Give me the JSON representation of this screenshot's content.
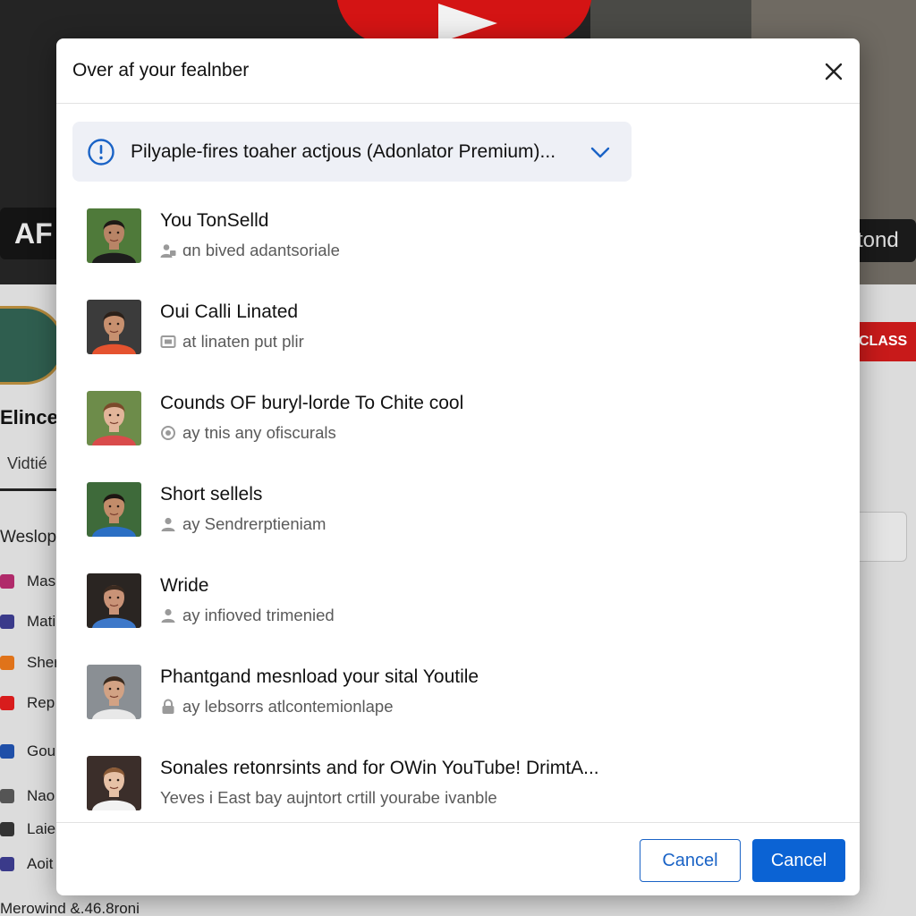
{
  "background": {
    "badge_left": "AF",
    "badge_right": "tond",
    "channel_name": "Elince",
    "tab_label": "Vidtié",
    "subscribe_label": "CLASS",
    "section_label": "Weslop",
    "sidebar": [
      {
        "label": "Mas",
        "icon": "heart-icon",
        "color": "#b02a6a"
      },
      {
        "label": "Mati",
        "icon": "list-icon",
        "color": "#3a3a8a"
      },
      {
        "label": "Sher",
        "icon": "image-icon",
        "color": "#e0731a"
      },
      {
        "label": "Rep",
        "icon": "play-icon",
        "color": "#d81c1c"
      },
      {
        "label": "Gou",
        "icon": "facebook-icon",
        "color": "#1f4fa8"
      },
      {
        "label": "Nao",
        "icon": "box-icon",
        "color": "#555555"
      },
      {
        "label": "Laie",
        "icon": "chat-icon",
        "color": "#333333"
      },
      {
        "label": "Aoit",
        "icon": "chart-icon",
        "color": "#3a3a8a"
      }
    ],
    "footer_text": "Merowind &.46.8roni"
  },
  "modal": {
    "title": "Over af your fealnber",
    "close_icon": "close-icon",
    "notice": {
      "text": "Pilyaple-fires toaher actjous (Adonlator Premium)...",
      "icon": "info-icon",
      "accent": "#1a63c6"
    },
    "items": [
      {
        "title": "You TonSelld",
        "subtitle": "ɑn bived adantsoriale",
        "icon": "person-lock-icon",
        "avatar_bg": "#4f7a3a",
        "skin": "#b88466",
        "hair": "#1e1a16",
        "shirt": "#1d1d1d"
      },
      {
        "title": "Oui Calli Linated",
        "subtitle": "at linaten put plir",
        "icon": "image-icon",
        "avatar_bg": "#3b3b3b",
        "skin": "#c7906f",
        "hair": "#2b2019",
        "shirt": "#e5532f"
      },
      {
        "title": "Counds OF buryl-lorde To Chite cool",
        "subtitle": "ay tnis any ofiscurals",
        "icon": "circle-icon",
        "avatar_bg": "#6d8c4a",
        "skin": "#e2b59a",
        "hair": "#7a4a2a",
        "shirt": "#d94b4b"
      },
      {
        "title": "Short sellels",
        "subtitle": "ay Sendrerptieniam",
        "icon": "person-icon",
        "avatar_bg": "#3e6a3a",
        "skin": "#c28c6a",
        "hair": "#1c1612",
        "shirt": "#2b6fc4"
      },
      {
        "title": "Wride",
        "subtitle": "ay infioved trimenied",
        "icon": "person-icon",
        "avatar_bg": "#2a2522",
        "skin": "#c99377",
        "hair": "#3a2a20",
        "shirt": "#3d78c9"
      },
      {
        "title": "Phantgand mesnload your sital Youtile",
        "subtitle": "ay lebsorrs atlcontemionlape",
        "icon": "lock-icon",
        "avatar_bg": "#8a8f94",
        "skin": "#d2a284",
        "hair": "#3a2a1e",
        "shirt": "#e8e8e8"
      },
      {
        "title": "Sonales retonrsints and for OWin YouTube! DrimtA...",
        "subtitle": "Yeves i East bay aujntort crtill yourabe ivanble",
        "icon": "",
        "avatar_bg": "#3b2e2a",
        "skin": "#e7c1a6",
        "hair": "#8a5a36",
        "shirt": "#f2f2f2"
      }
    ],
    "footer": {
      "secondary_label": "Cancel",
      "primary_label": "Cancel",
      "primary_color": "#0b63d4"
    }
  }
}
